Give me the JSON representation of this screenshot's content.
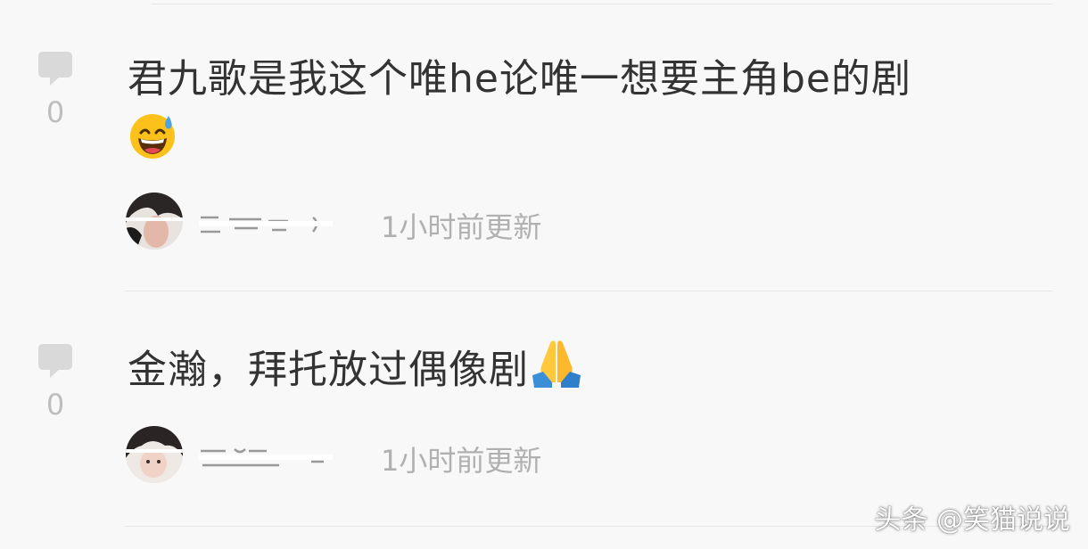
{
  "comments": [
    {
      "like_count": "0",
      "text": "君九歌是我这个唯he论唯一想要主角be的剧",
      "emoji_icon": "grinning-face-with-sweat-icon",
      "time": "1小时前更新"
    },
    {
      "like_count": "0",
      "text": "金瀚，拜托放过偶像剧",
      "emoji_icon": "folded-hands-icon",
      "time": "1小时前更新"
    }
  ],
  "watermark": "头条 @笑猫说说",
  "colors": {
    "background": "#f8f8f8",
    "text": "#333333",
    "muted": "#b0b0b0",
    "icon": "#d9d9d9"
  }
}
